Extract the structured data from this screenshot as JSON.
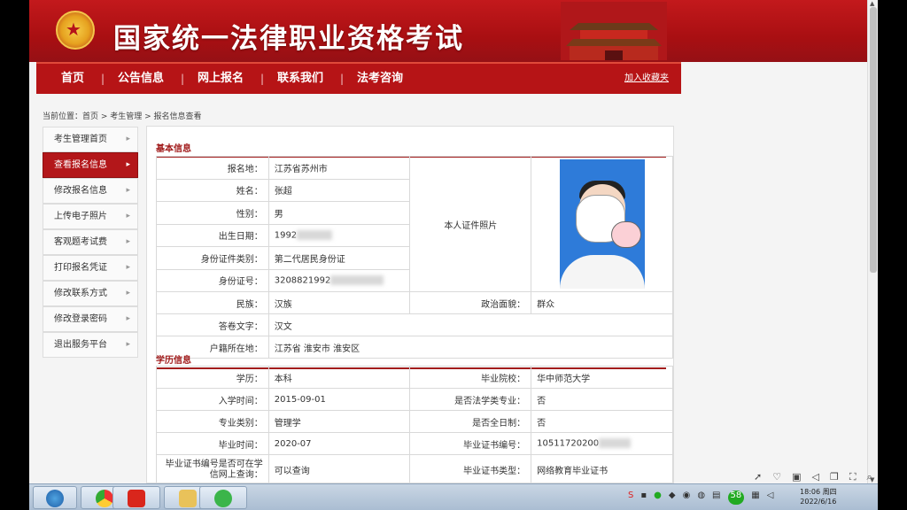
{
  "header": {
    "site_title": "国家统一法律职业资格考试",
    "emblem_icon": "national-emblem-icon",
    "fav_link": "加入收藏夹"
  },
  "nav": {
    "items": [
      "首页",
      "公告信息",
      "网上报名",
      "联系我们",
      "法考咨询"
    ],
    "separator": "|"
  },
  "breadcrumb": "当前位置：首页 > 考生管理 > 报名信息查看",
  "sidebar": {
    "items": [
      {
        "label": "考生管理首页",
        "active": false
      },
      {
        "label": "查看报名信息",
        "active": true
      },
      {
        "label": "修改报名信息",
        "active": false
      },
      {
        "label": "上传电子照片",
        "active": false
      },
      {
        "label": "客观题考试费",
        "active": false
      },
      {
        "label": "打印报名凭证",
        "active": false
      },
      {
        "label": "修改联系方式",
        "active": false
      },
      {
        "label": "修改登录密码",
        "active": false
      },
      {
        "label": "退出服务平台",
        "active": false
      }
    ],
    "arrow": "▸"
  },
  "basic": {
    "title": "基本信息",
    "reg_place_label": "报名地：",
    "reg_place": "江苏省苏州市",
    "name_label": "姓名：",
    "name": "张超",
    "gender_label": "性别：",
    "gender": "男",
    "birth_label": "出生日期：",
    "birth": "1992",
    "id_type_label": "身份证件类别：",
    "id_type": "第二代居民身份证",
    "id_no_label": "身份证号：",
    "id_no": "3208821992",
    "photo_label": "本人证件照片",
    "ethnic_label": "民族：",
    "ethnic": "汉族",
    "political_label": "政治面貌：",
    "political": "群众",
    "lang_label": "答卷文字：",
    "lang": "汉文",
    "household_label": "户籍所在地：",
    "household": "江苏省 淮安市 淮安区"
  },
  "edu": {
    "title": "学历信息",
    "degree_label": "学历：",
    "degree": "本科",
    "school_label": "毕业院校：",
    "school": "华中师范大学",
    "enroll_label": "入学时间：",
    "enroll": "2015-09-01",
    "law_label": "是否法学类专业：",
    "law": "否",
    "major_label": "专业类别：",
    "major": "管理学",
    "fulltime_label": "是否全日制：",
    "fulltime": "否",
    "grad_label": "毕业时间：",
    "grad": "2020-07",
    "cert_no_label": "毕业证书编号：",
    "cert_no": "10511720200",
    "online_label": "毕业证书编号是否可在学信网上查询：",
    "online": "可以查询",
    "cert_type_label": "毕业证书类型：",
    "cert_type": "网络教育毕业证书"
  },
  "taskbar": {
    "clock_time": "18:06 周四",
    "clock_date": "2022/6/16",
    "tray_badge": "58"
  }
}
